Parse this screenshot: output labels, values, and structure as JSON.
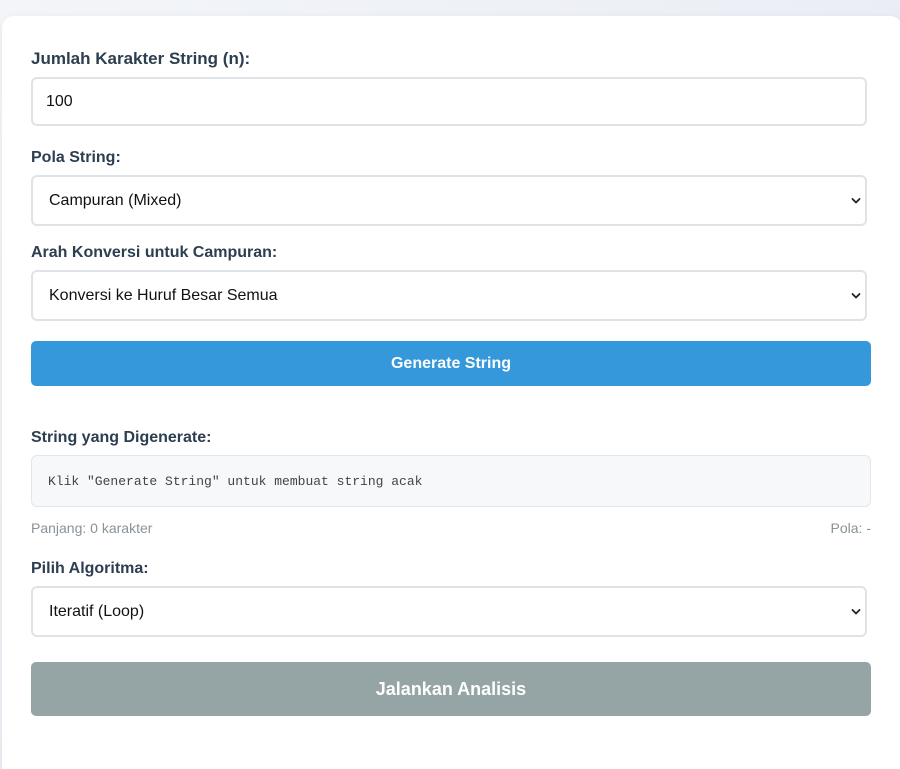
{
  "form": {
    "length_label": "Jumlah Karakter String (n):",
    "length_value": "100",
    "pattern_label": "Pola String:",
    "pattern_selected": "Campuran (Mixed)",
    "conversion_label": "Arah Konversi untuk Campuran:",
    "conversion_selected": "Konversi ke Huruf Besar Semua",
    "generate_button": "Generate String"
  },
  "output": {
    "label": "String yang Digenerate:",
    "placeholder_text": "Klik \"Generate String\" untuk membuat string acak",
    "length_info": "Panjang: 0 karakter",
    "pattern_info": "Pola: -"
  },
  "algorithm": {
    "label": "Pilih Algoritma:",
    "selected": "Iteratif (Loop)",
    "run_button": "Jalankan Analisis"
  },
  "colors": {
    "primary": "#3498db",
    "disabled": "#95a5a6",
    "text": "#2c3e50"
  },
  "icons": {
    "select_arrow": "chevron-down-icon"
  }
}
